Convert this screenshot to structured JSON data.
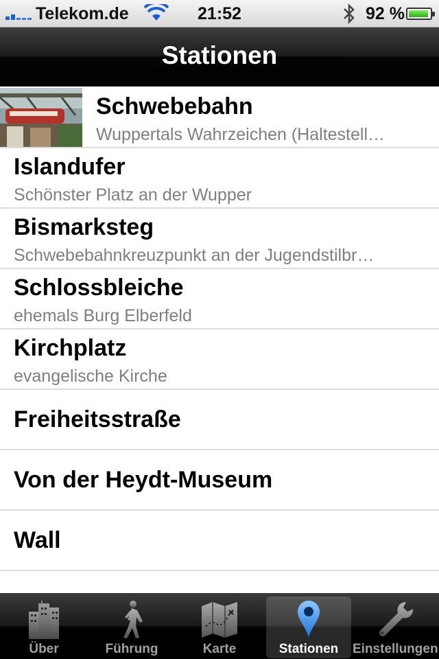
{
  "status_bar": {
    "carrier": "Telekom.de",
    "time": "21:52",
    "battery_percent_text": "92 %",
    "battery_level": 0.92,
    "icons": [
      "signal-icon",
      "wifi-icon",
      "bluetooth-icon",
      "battery-icon"
    ]
  },
  "nav": {
    "title": "Stationen"
  },
  "stations": [
    {
      "title": "Schwebebahn",
      "subtitle": "Wuppertals Wahrzeichen (Haltestell…"
    },
    {
      "title": "Islandufer",
      "subtitle": "Schönster Platz an der Wupper"
    },
    {
      "title": "Bismarksteg",
      "subtitle": "Schwebebahnkreuzpunkt an der Jugendstilbr…"
    },
    {
      "title": "Schlossbleiche",
      "subtitle": "ehemals Burg Elberfeld"
    },
    {
      "title": "Kirchplatz",
      "subtitle": "evangelische Kirche"
    },
    {
      "title": "Freiheitsstraße"
    },
    {
      "title": "Von der Heydt-Museum"
    },
    {
      "title": "Wall"
    }
  ],
  "tabs": [
    {
      "label": "Über",
      "icon": "buildings-icon"
    },
    {
      "label": "Führung",
      "icon": "walking-person-icon"
    },
    {
      "label": "Karte",
      "icon": "map-icon"
    },
    {
      "label": "Stationen",
      "icon": "location-pin-icon",
      "active": true
    },
    {
      "label": "Einstellungen",
      "icon": "wrench-icon"
    }
  ],
  "colors": {
    "active_tab_icon": "#3d8fe6",
    "inactive_tab": "#a0a0a0",
    "subtitle": "#7f7f7f"
  }
}
